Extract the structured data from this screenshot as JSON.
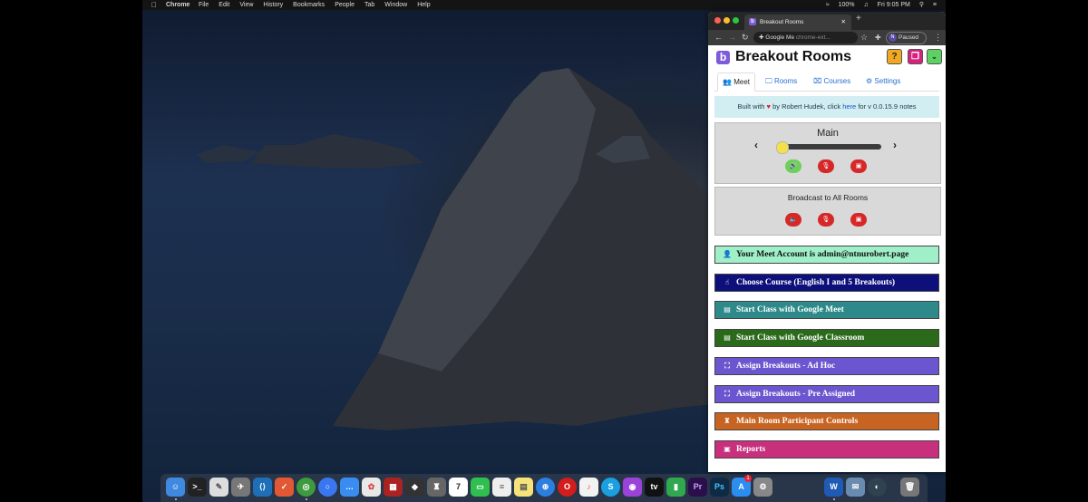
{
  "menubar": {
    "app_name": "Chrome",
    "menus": [
      "File",
      "Edit",
      "View",
      "History",
      "Bookmarks",
      "People",
      "Tab",
      "Window",
      "Help"
    ],
    "battery": "100%",
    "clock": "Fri 9:05 PM"
  },
  "browser": {
    "tab_title": "Breakout Rooms",
    "tab_favicon": "b",
    "url_title": "Google Me",
    "url_ext": "chrome-ext...",
    "profile_initial": "N",
    "profile_status": "Paused"
  },
  "popup": {
    "title": "Breakout Rooms",
    "logo": "b",
    "tabs": [
      {
        "label": "Meet",
        "icon": "users-icon"
      },
      {
        "label": "Rooms",
        "icon": "monitor-icon"
      },
      {
        "label": "Courses",
        "icon": "chalkboard-icon"
      },
      {
        "label": "Settings",
        "icon": "gear-icon"
      }
    ],
    "notice": {
      "prefix": "Built with",
      "heart": "♥",
      "by": "by Robert Hudek, click",
      "link": "here",
      "suffix": "for v 0.0.15.9 notes"
    },
    "main_panel": {
      "title": "Main",
      "prev_symbol": "‹",
      "next_symbol": "›",
      "slider_level": 0
    },
    "broadcast_panel": {
      "title": "Broadcast to All Rooms"
    },
    "actions": [
      {
        "label": "Your Meet Account is admin@ntnurobert.page",
        "icon": "user-icon",
        "color": "#9ff0c8",
        "text_color": "#111111"
      },
      {
        "label": "Choose Course (English I and 5 Breakouts)",
        "icon": "pointer-icon",
        "color": "#0d0f7a",
        "text_color": "#ffffff"
      },
      {
        "label": "Start Class with Google Meet",
        "icon": "id-card-icon",
        "color": "#2e8a8a",
        "text_color": "#ffffff"
      },
      {
        "label": "Start Class with Google Classroom",
        "icon": "id-card-icon",
        "color": "#2b6a1a",
        "text_color": "#ffffff"
      },
      {
        "label": "Assign Breakouts - Ad Hoc",
        "icon": "sitemap-icon",
        "color": "#6b56cf",
        "text_color": "#ffffff"
      },
      {
        "label": "Assign Breakouts - Pre Assigned",
        "icon": "sitemap-icon",
        "color": "#6b56cf",
        "text_color": "#ffffff"
      },
      {
        "label": "Main Room Participant Controls",
        "icon": "podium-icon",
        "color": "#c86422",
        "text_color": "#ffffff"
      },
      {
        "label": "Reports",
        "icon": "clipboard-icon",
        "color": "#c8307d",
        "text_color": "#ffffff"
      }
    ]
  },
  "dock_badge": "1"
}
